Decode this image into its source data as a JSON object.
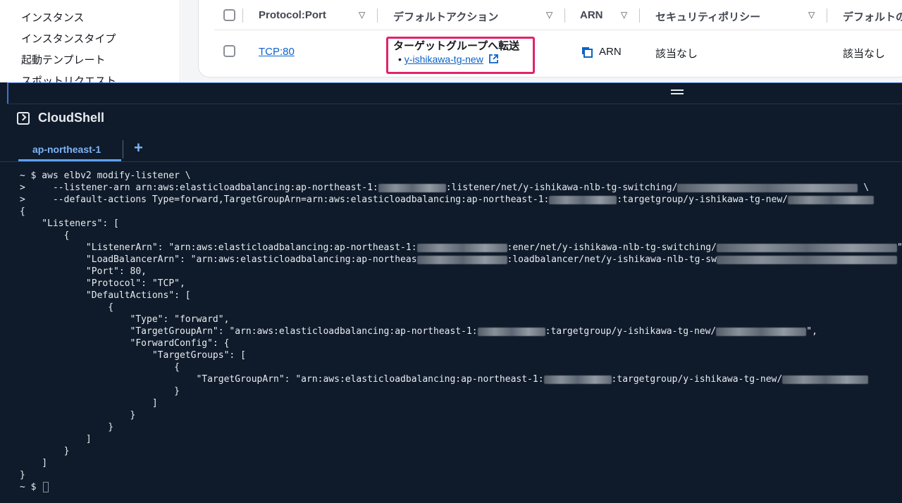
{
  "sidebar": {
    "items": [
      {
        "label": "インスタンス"
      },
      {
        "label": "インスタンスタイプ"
      },
      {
        "label": "起動テンプレート"
      },
      {
        "label": "スポットリクエスト"
      }
    ]
  },
  "listener_table": {
    "headers": {
      "protocol_port": "Protocol:Port",
      "default_action": "デフォルトアクション",
      "arn": "ARN",
      "security_policy": "セキュリティポリシー",
      "default_cert": "デフォルトの"
    },
    "row": {
      "protocol_port": "TCP:80",
      "action_title": "ターゲットグループへ転送",
      "target_group_link": "y-ishikawa-tg-new",
      "arn_label": "ARN",
      "security_policy": "該当なし",
      "default_cert": "該当なし"
    }
  },
  "cloudshell": {
    "title": "CloudShell",
    "tab_label": "ap-northeast-1",
    "add_tab": "+",
    "terminal": {
      "prompt1": "~ $ aws elbv2 modify-listener \\",
      "l2a": ">     --listener-arn arn:aws:elasticloadbalancing:ap-northeast-1:",
      "l2b": ":listener/net/y-ishikawa-nlb-tg-switching/",
      "l2c": " \\",
      "l3a": ">     --default-actions Type=forward,TargetGroupArn=arn:aws:elasticloadbalancing:ap-northeast-1:",
      "l3b": ":targetgroup/y-ishikawa-tg-new/",
      "l4": "{",
      "l5": "    \"Listeners\": [",
      "l6": "        {",
      "l7a": "            \"ListenerArn\": \"arn:aws:elasticloadbalancing:ap-northeast-1:",
      "l7b": ":ener/net/y-ishikawa-nlb-tg-switching/",
      "l7c": "\",",
      "l8a": "            \"LoadBalancerArn\": \"arn:aws:elasticloadbalancing:ap-northeas",
      "l8b": ":loadbalancer/net/y-ishikawa-nlb-tg-sw",
      "l9": "            \"Port\": 80,",
      "l10": "            \"Protocol\": \"TCP\",",
      "l11": "            \"DefaultActions\": [",
      "l12": "                {",
      "l13": "                    \"Type\": \"forward\",",
      "l14a": "                    \"TargetGroupArn\": \"arn:aws:elasticloadbalancing:ap-northeast-1:",
      "l14b": ":targetgroup/y-ishikawa-tg-new/",
      "l14c": "\",",
      "l15": "                    \"ForwardConfig\": {",
      "l16": "                        \"TargetGroups\": [",
      "l17": "                            {",
      "l18a": "                                \"TargetGroupArn\": \"arn:aws:elasticloadbalancing:ap-northeast-1:",
      "l18b": ":targetgroup/y-ishikawa-tg-new/",
      "l19": "                            }",
      "l20": "                        ]",
      "l21": "                    }",
      "l22": "                }",
      "l23": "            ]",
      "l24": "        }",
      "l25": "    ]",
      "l26": "}",
      "prompt2": "~ $ "
    }
  },
  "colors": {
    "link": "#0b62c9",
    "highlight": "#e3226a",
    "cloudshell_bg": "#0f1b2a",
    "tab_accent": "#5fa0f0"
  }
}
